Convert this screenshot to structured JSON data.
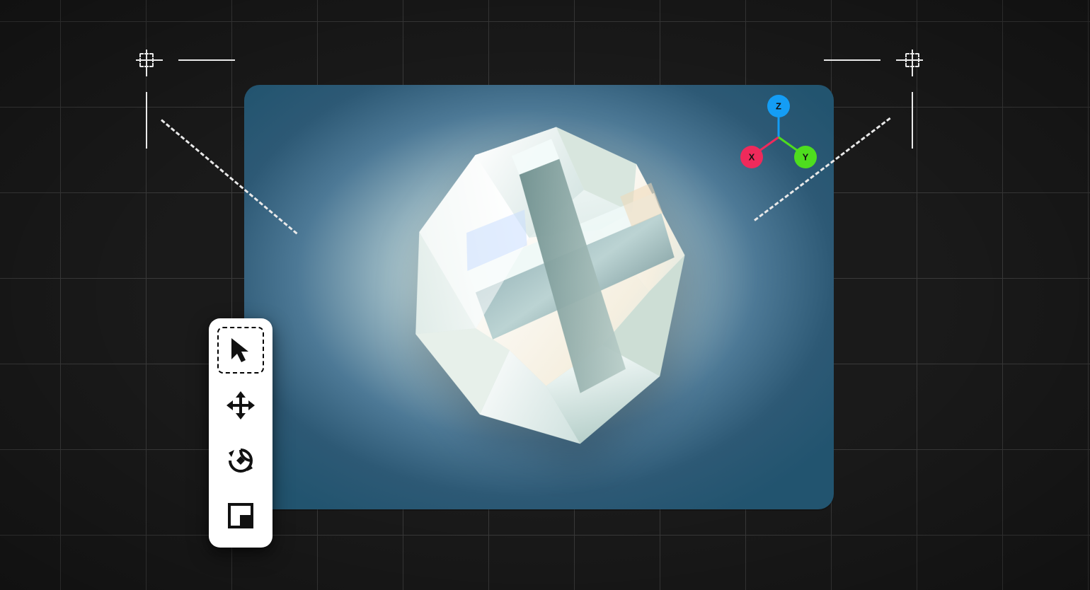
{
  "axes": {
    "z": {
      "label": "Z",
      "color": "#149df5"
    },
    "x": {
      "label": "X",
      "color": "#ef2a5b"
    },
    "y": {
      "label": "Y",
      "color": "#4edd1e"
    }
  },
  "tools": [
    {
      "id": "select",
      "name": "select-tool",
      "selected": true
    },
    {
      "id": "move",
      "name": "move-tool",
      "selected": false
    },
    {
      "id": "rotate",
      "name": "rotate-tool",
      "selected": false
    },
    {
      "id": "scale",
      "name": "scale-tool",
      "selected": false
    }
  ],
  "viewport": {
    "bg_inner": "#e7f0ed",
    "bg_outer": "#22546f"
  }
}
